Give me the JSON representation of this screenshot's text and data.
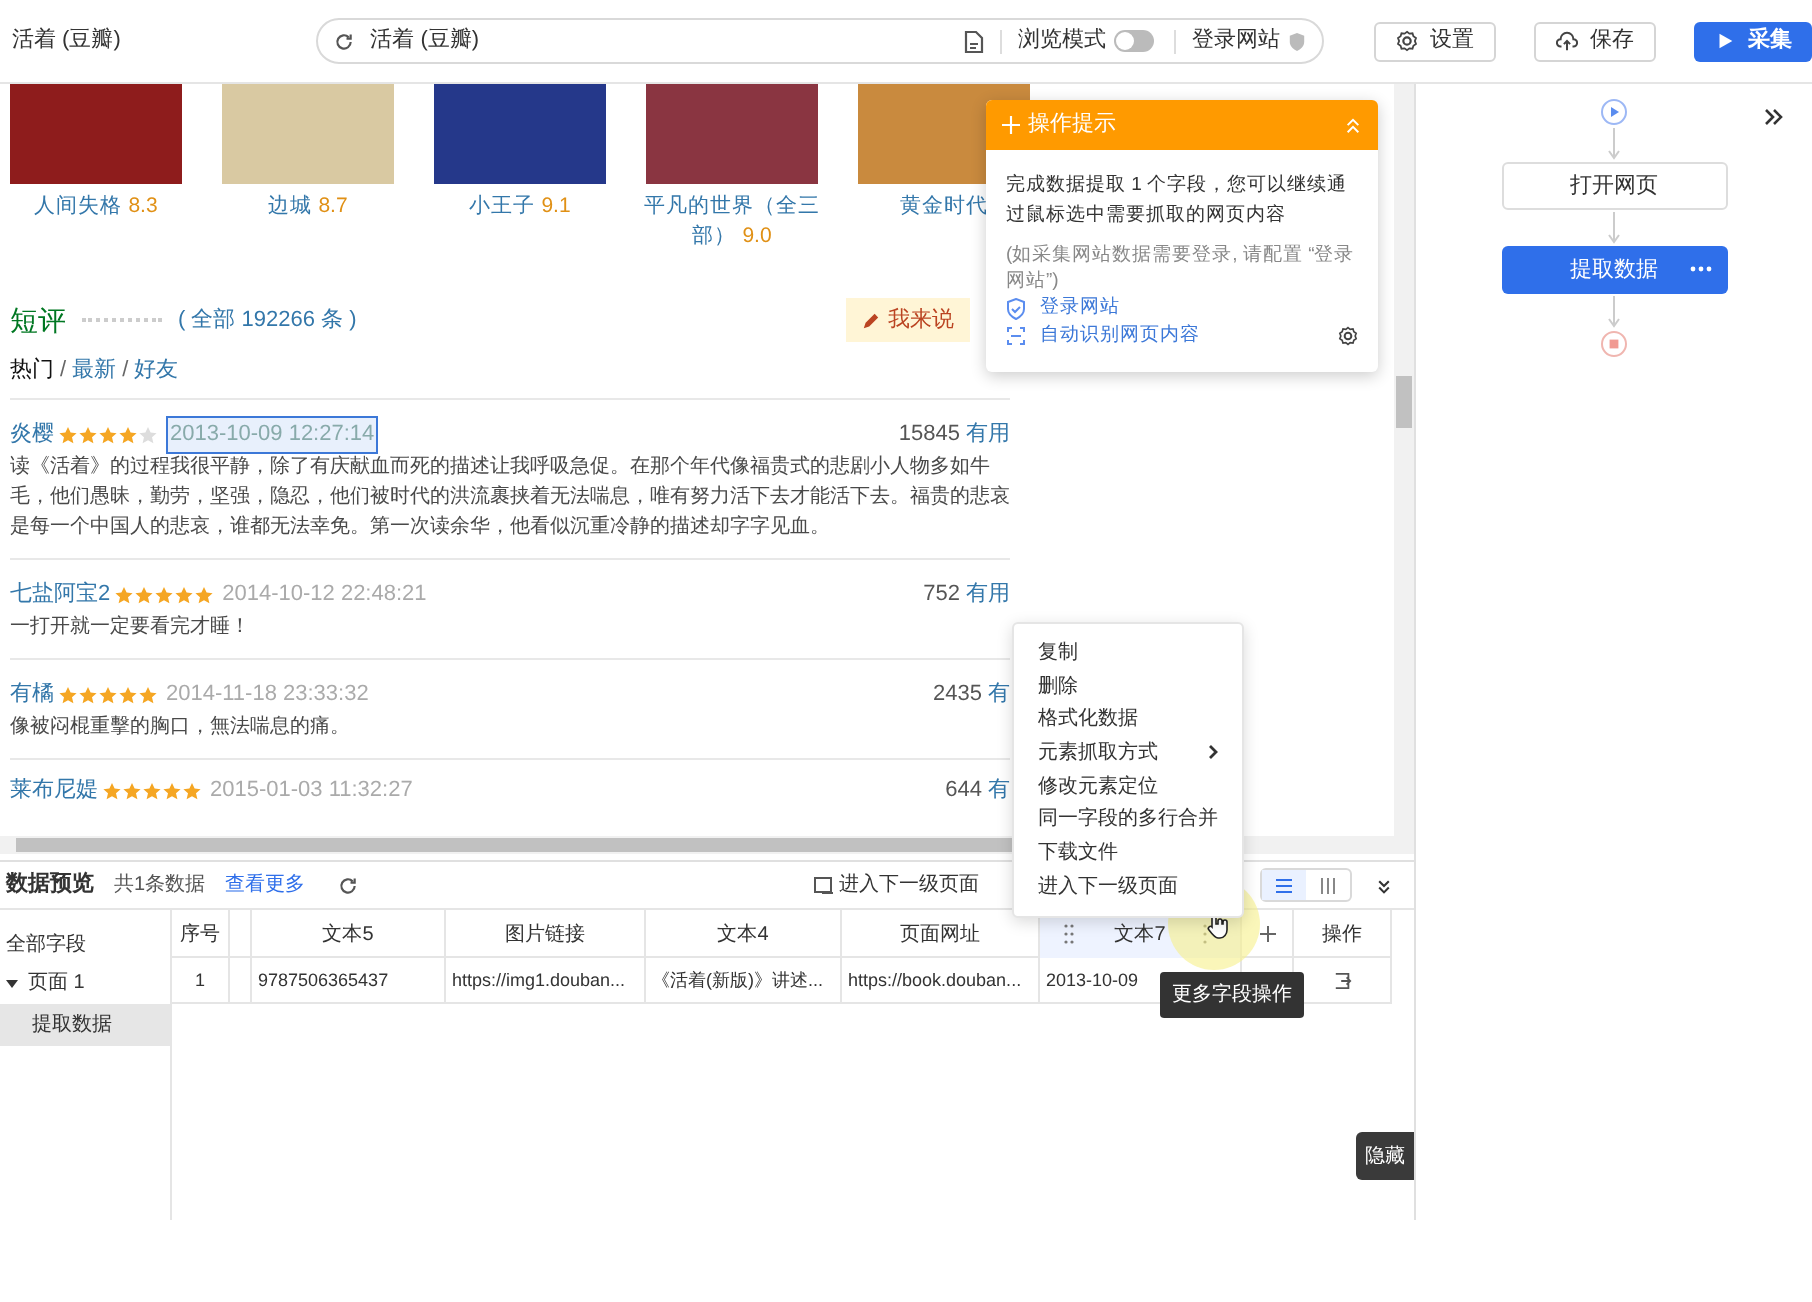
{
  "window": {
    "title": "活着 (豆瓣)"
  },
  "address_bar": {
    "value": "活着 (豆瓣)",
    "browse_mode_label": "浏览模式",
    "browse_mode_on": false,
    "login_label": "登录网站"
  },
  "toolbar_buttons": [
    {
      "kind": "settings",
      "label": "设置"
    },
    {
      "kind": "save",
      "label": "保存"
    },
    {
      "kind": "collect",
      "label": "采集"
    }
  ],
  "books": [
    {
      "title": "人间失格",
      "rating": "8.3",
      "color": "#8e1c1c"
    },
    {
      "title": "边城",
      "rating": "8.7",
      "color": "#d9c9a2"
    },
    {
      "title": "小王子",
      "rating": "9.1",
      "color": "#25388a"
    },
    {
      "title": "平凡的世界（全三部）",
      "rating": "9.0",
      "color": "#8a3541"
    },
    {
      "title": "黄金时代",
      "color": "#c98a3e"
    }
  ],
  "comments": {
    "title": "短评",
    "total": "( 全部 192266 条 )",
    "write_button": "我来说",
    "filter_separator": "/",
    "filters": [
      {
        "label": "热门",
        "selected": true
      },
      {
        "label": "最新",
        "selected": false
      },
      {
        "label": "好友",
        "selected": false
      }
    ]
  },
  "reviews": [
    {
      "user": "炎樱",
      "stars": 4,
      "time": "2013-10-09 12:27:14",
      "highlighted": true,
      "votes": "15845",
      "useful": "有用",
      "text": "读《活着》的过程我很平静，除了有庆献血而死的描述让我呼吸急促。在那个年代像福贵式的悲剧小人物多如牛毛，他们愚昧，勤劳，坚强，隐忍，他们被时代的洪流裹挟着无法喘息，唯有努力活下去才能活下去。福贵的悲哀是每一个中国人的悲哀，谁都无法幸免。第一次读余华，他看似沉重冷静的描述却字字见血。"
    },
    {
      "user": "七盐阿宝2",
      "stars": 5,
      "time": "2014-10-12 22:48:21",
      "highlighted": false,
      "votes": "752",
      "useful": "有用",
      "text": "一打开就一定要看完才睡！"
    },
    {
      "user": "有橘",
      "stars": 5,
      "time": "2014-11-18 23:33:32",
      "highlighted": false,
      "votes": "2435",
      "useful": "有",
      "text": "像被闷棍重擊的胸口，無法喘息的痛。"
    },
    {
      "user": "莱布尼媞",
      "stars": 5,
      "time": "2015-01-03 11:32:27",
      "highlighted": false,
      "votes": "644",
      "useful": "有"
    }
  ],
  "tip_popup": {
    "title": "操作提示",
    "message": "完成数据提取 1 个字段，您可以继续通过鼠标选中需要抓取的网页内容",
    "note": "(如采集网站数据需要登录, 请配置 “登录网站”)",
    "links": [
      {
        "kind": "login",
        "label": "登录网站"
      },
      {
        "kind": "auto",
        "label": "自动识别网页内容"
      }
    ]
  },
  "context_menu": [
    {
      "label": "复制",
      "submenu": false
    },
    {
      "label": "删除",
      "submenu": false
    },
    {
      "label": "格式化数据",
      "submenu": false
    },
    {
      "label": "元素抓取方式",
      "submenu": true
    },
    {
      "label": "修改元素定位",
      "submenu": false
    },
    {
      "label": "同一字段的多行合并",
      "submenu": false
    },
    {
      "label": "下载文件",
      "submenu": false
    },
    {
      "label": "进入下一级页面",
      "submenu": false
    }
  ],
  "workflow": [
    {
      "kind": "start"
    },
    {
      "kind": "step",
      "label": "打开网页",
      "selected": false
    },
    {
      "kind": "step",
      "label": "提取数据",
      "selected": true
    },
    {
      "kind": "end"
    }
  ],
  "data_preview": {
    "title": "数据预览",
    "count": "共1条数据",
    "more_link": "查看更多",
    "next_level_button": "进入下一级页面",
    "view_modes": [
      {
        "kind": "list",
        "selected": true
      },
      {
        "kind": "columns",
        "selected": false
      }
    ]
  },
  "field_tree": {
    "label": "全部字段",
    "children": [
      {
        "label": "页面 1",
        "expanded": true,
        "selected": false,
        "children": [
          {
            "label": "提取数据",
            "selected": true
          }
        ]
      }
    ]
  },
  "table": {
    "columns": [
      {
        "label": "序号",
        "selected": false
      },
      {
        "label": "文本5",
        "selected": false
      },
      {
        "label": "图片链接",
        "selected": false
      },
      {
        "label": "文本4",
        "selected": false
      },
      {
        "label": "页面网址",
        "selected": false
      },
      {
        "label": "文本7",
        "selected": true
      },
      {
        "label": "操作",
        "selected": false
      }
    ],
    "rows": [
      [
        "1",
        "9787506365437",
        "https://img1.douban...",
        "《活着(新版)》讲述...",
        "https://book.douban...",
        "2013-10-09"
      ]
    ]
  },
  "tooltip": "更多字段操作",
  "hide_button": "隐藏"
}
